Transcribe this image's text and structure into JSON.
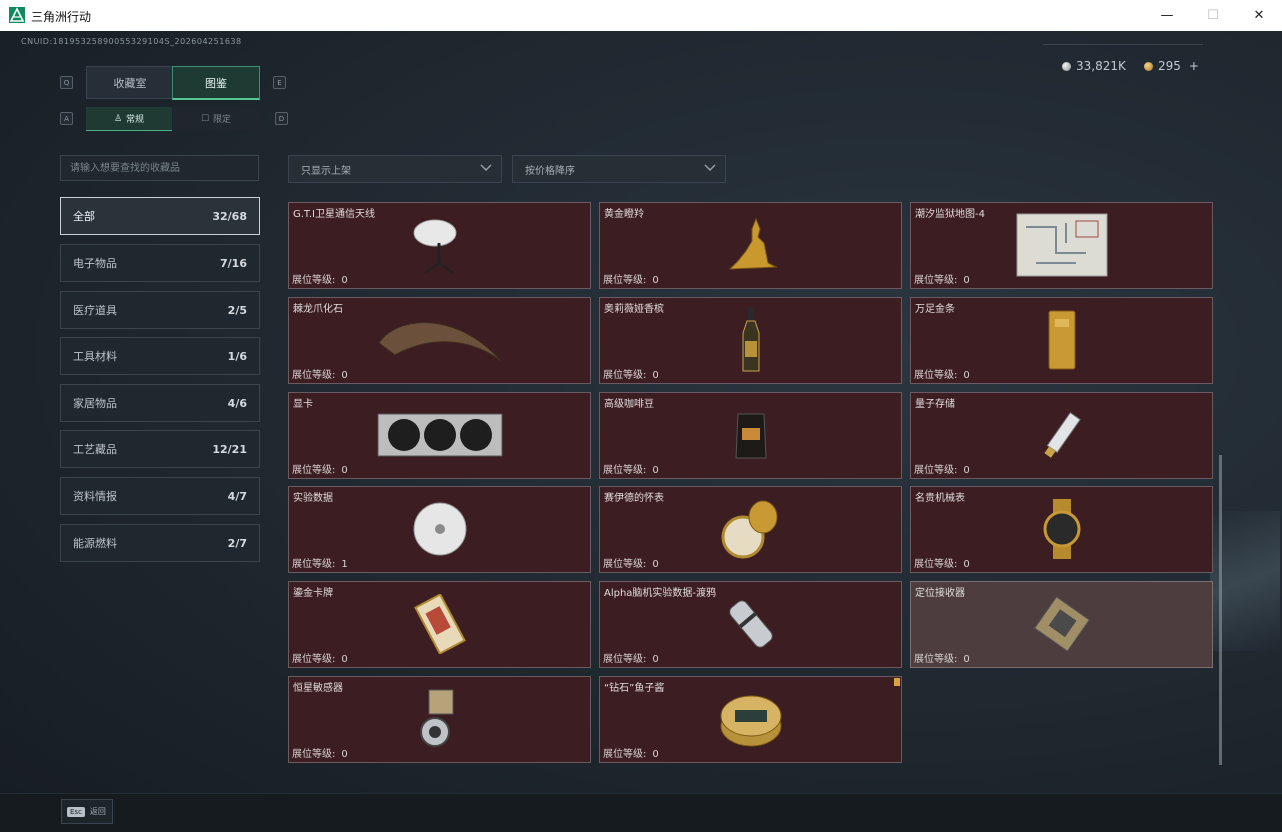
{
  "window": {
    "title": "三角洲行动",
    "controls": {
      "minimize": "—",
      "maximize": "☐",
      "close": "✕"
    }
  },
  "header": {
    "cnuid": "CNUID:18195325890055329104S_202604251638",
    "silver": "33,821K",
    "gold": "295",
    "add": "+"
  },
  "keys": {
    "tab_left": "Q",
    "tab_right": "E",
    "sub_left": "A",
    "sub_right": "D"
  },
  "tabs": {
    "collection": "收藏室",
    "catalog": "图鉴",
    "normal": "常规",
    "limited": "限定"
  },
  "search": {
    "placeholder": "请输入想要查找的收藏品"
  },
  "filters": {
    "shelf": "只显示上架",
    "sort": "按价格降序"
  },
  "categories": [
    {
      "name": "全部",
      "count": "32/68"
    },
    {
      "name": "电子物品",
      "count": "7/16"
    },
    {
      "name": "医疗道具",
      "count": "2/5"
    },
    {
      "name": "工具材料",
      "count": "1/6"
    },
    {
      "name": "家居物品",
      "count": "4/6"
    },
    {
      "name": "工艺藏品",
      "count": "12/21"
    },
    {
      "name": "资料情报",
      "count": "4/7"
    },
    {
      "name": "能源燃料",
      "count": "2/7"
    }
  ],
  "level_label": "展位等级:",
  "items": [
    {
      "name": "G.T.I卫星通信天线",
      "level": "0",
      "icon": "satellite-dish-icon"
    },
    {
      "name": "黄金瞪羚",
      "level": "0",
      "icon": "golden-gazelle-icon"
    },
    {
      "name": "潮汐监狱地图-4",
      "level": "0",
      "icon": "map-icon"
    },
    {
      "name": "棘龙爪化石",
      "level": "0",
      "icon": "claw-fossil-icon"
    },
    {
      "name": "奥莉薇娅香槟",
      "level": "0",
      "icon": "champagne-bottle-icon"
    },
    {
      "name": "万足金条",
      "level": "0",
      "icon": "gold-bar-icon"
    },
    {
      "name": "显卡",
      "level": "0",
      "icon": "graphics-card-icon"
    },
    {
      "name": "高级咖啡豆",
      "level": "0",
      "icon": "coffee-bag-icon"
    },
    {
      "name": "量子存储",
      "level": "0",
      "icon": "quantum-storage-icon"
    },
    {
      "name": "实验数据",
      "level": "1",
      "icon": "data-disc-icon"
    },
    {
      "name": "赛伊德的怀表",
      "level": "0",
      "icon": "pocket-watch-icon"
    },
    {
      "name": "名贵机械表",
      "level": "0",
      "icon": "wristwatch-icon"
    },
    {
      "name": "鎏金卡牌",
      "level": "0",
      "icon": "gilded-card-icon"
    },
    {
      "name": "Alpha脑机实验数据-渡鸦",
      "level": "0",
      "icon": "data-cylinder-icon"
    },
    {
      "name": "定位接收器",
      "level": "0",
      "icon": "gps-receiver-icon"
    },
    {
      "name": "恒星敏感器",
      "level": "0",
      "icon": "star-sensor-icon"
    },
    {
      "name": "“钻石”鱼子酱",
      "level": "0",
      "icon": "caviar-tin-icon"
    }
  ],
  "footer": {
    "esc_key": "Esc",
    "back": "返回"
  }
}
